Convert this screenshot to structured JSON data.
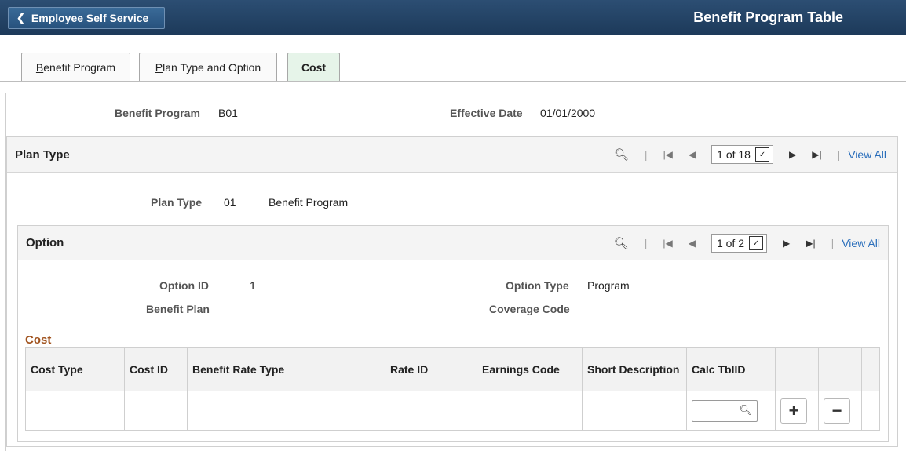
{
  "header": {
    "back_label": "Employee Self Service",
    "title": "Benefit Program Table"
  },
  "tabs": [
    {
      "label": "Benefit Program",
      "underline": "B",
      "rest": "enefit Program",
      "active": false
    },
    {
      "label": "Plan Type and Option",
      "underline": "P",
      "rest": "lan Type and Option",
      "active": false
    },
    {
      "label": "Cost",
      "active": true
    }
  ],
  "program": {
    "benefit_program_label": "Benefit Program",
    "benefit_program_value": "B01",
    "effective_date_label": "Effective Date",
    "effective_date_value": "01/01/2000"
  },
  "plan_type_group": {
    "title": "Plan Type",
    "pager": "1 of 18",
    "view_all": "View All",
    "plan_type_label": "Plan Type",
    "plan_type_code": "01",
    "plan_type_desc": "Benefit Program"
  },
  "option_group": {
    "title": "Option",
    "pager": "1 of 2",
    "view_all": "View All",
    "option_id_label": "Option ID",
    "option_id_value": "1",
    "option_type_label": "Option Type",
    "option_type_value": "Program",
    "benefit_plan_label": "Benefit Plan",
    "coverage_code_label": "Coverage Code"
  },
  "cost": {
    "title": "Cost",
    "columns": [
      "Cost Type",
      "Cost ID",
      "Benefit Rate Type",
      "Rate ID",
      "Earnings Code",
      "Short Description",
      "Calc TblID",
      "",
      ""
    ],
    "add_symbol": "+",
    "remove_symbol": "−"
  },
  "icons": {
    "search": "search-icon",
    "first": "first-page-icon",
    "prev": "previous-icon",
    "next": "next-icon",
    "last": "last-page-icon"
  },
  "colors": {
    "header_bg": "#1d3a5a",
    "active_tab": "#e6f4e9",
    "link": "#2a6ebb",
    "cost_title": "#a0521d"
  }
}
